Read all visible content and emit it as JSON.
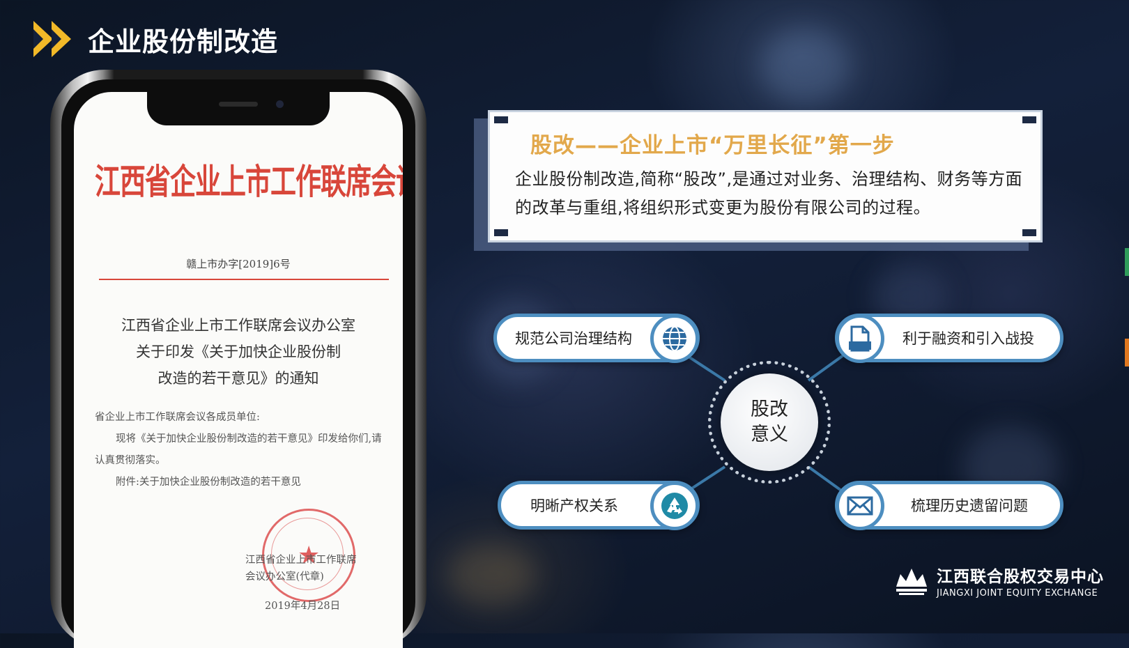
{
  "header": {
    "title": "企业股份制改造"
  },
  "document": {
    "header": "江西省企业上市工作联席会议办公室文件",
    "number": "赣上市办字[2019]6号",
    "title_lines": [
      "江西省企业上市工作联席会议办公室",
      "关于印发《关于加快企业股份制",
      "改造的若干意见》的通知"
    ],
    "addressee": "省企业上市工作联席会议各成员单位:",
    "body": "现将《关于加快企业股份制改造的若干意见》印发给你们,请认真贯彻落实。",
    "attachment": "附件:关于加快企业股份制改造的若干意见",
    "signature": "江西省企业上市工作联席会议办公室(代章)",
    "date": "2019年4月28日"
  },
  "card": {
    "title": "股改——企业上市“万里长征”第一步",
    "text": "企业股份制改造,简称“股改”,是通过对业务、治理结构、财务等方面的改革与重组,将组织形式变更为股份有限公司的过程。"
  },
  "mindmap": {
    "hub_line1": "股改",
    "hub_line2": "意义",
    "items": [
      {
        "label": "规范公司治理结构",
        "icon": "globe-icon"
      },
      {
        "label": "利于融资和引入战投",
        "icon": "document-icon"
      },
      {
        "label": "明晰产权关系",
        "icon": "recycle-icon"
      },
      {
        "label": "梳理历史遗留问题",
        "icon": "mail-icon"
      }
    ]
  },
  "logo": {
    "cn": "江西联合股权交易中心",
    "en": "JIANGXI JOINT EQUITY EXCHANGE"
  },
  "colors": {
    "accent_yellow": "#f2b928",
    "doc_red": "#d8463a",
    "card_title_gold": "#e2a84b",
    "pill_border_blue": "#4d8ec0",
    "navy": "#1d2a44"
  }
}
